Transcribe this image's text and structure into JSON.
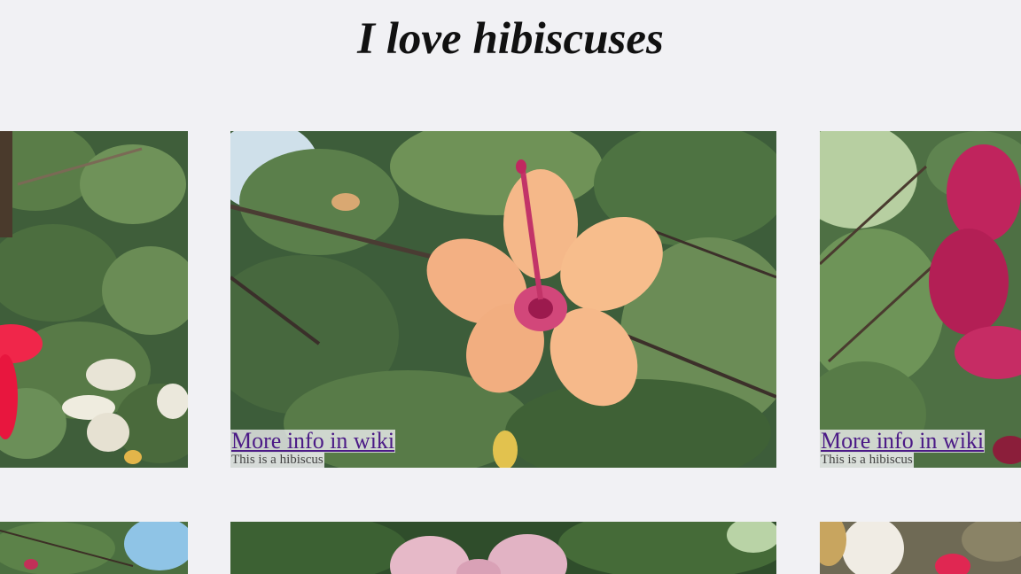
{
  "page": {
    "title": "I love hibiscuses"
  },
  "gallery": {
    "cards": [
      {
        "link_text": "More info in wiki",
        "description": "This is a hibiscus"
      },
      {
        "link_text": "More info in wiki",
        "description": "This is a hibiscus"
      }
    ]
  },
  "colors": {
    "background": "#f1f1f4",
    "link": "#4b1a86",
    "title": "#111111"
  }
}
